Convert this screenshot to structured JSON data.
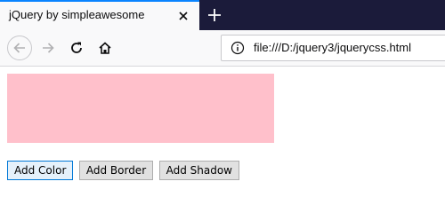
{
  "tab": {
    "title": "jQuery by simpleawesome"
  },
  "urlbar": {
    "url": "file:///D:/jquery3/jquerycss.html"
  },
  "icons": {
    "tab_close": "close-icon",
    "new_tab": "plus-icon",
    "back": "arrow-left-icon",
    "forward": "arrow-right-icon",
    "reload": "reload-icon",
    "home": "home-icon",
    "site_info": "info-icon"
  },
  "page": {
    "box_color": "#ffc0cb",
    "buttons": [
      {
        "label": "Add Color"
      },
      {
        "label": "Add Border"
      },
      {
        "label": "Add Shadow"
      }
    ]
  },
  "colors": {
    "tabstrip": "#1b1b3a",
    "tab_accent": "#0a84ff",
    "toolbar": "#f9f9fa"
  }
}
